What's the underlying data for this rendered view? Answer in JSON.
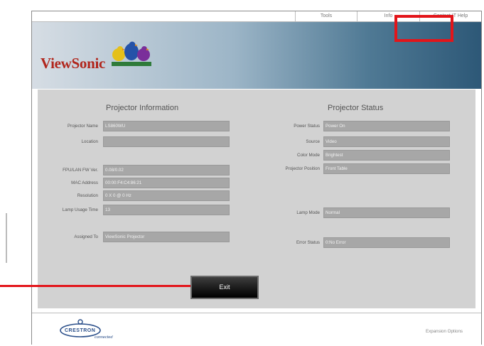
{
  "nav": {
    "tools": "Tools",
    "info": "Info",
    "contact": "Contact IT Help"
  },
  "brand": {
    "name": "ViewSonic"
  },
  "info": {
    "heading": "Projector Information",
    "fields": [
      {
        "label": "Projector Name",
        "value": "LS860WU"
      },
      {
        "label": "Location",
        "value": ""
      },
      {
        "label": "FPU/LAN FW Ver.",
        "value": "0.08/0.02"
      },
      {
        "label": "MAC Address",
        "value": "00:00:F4:C4:86:21"
      },
      {
        "label": "Resolution",
        "value": "0 X 0 @ 0 Hz"
      },
      {
        "label": "Lamp Usage Time",
        "value": "13"
      },
      {
        "label": "Assigned To",
        "value": "ViewSonic Projector"
      }
    ]
  },
  "status": {
    "heading": "Projector Status",
    "fields": [
      {
        "label": "Power Status",
        "value": "Power On"
      },
      {
        "label": "Source",
        "value": "Video"
      },
      {
        "label": "Color Mode",
        "value": "Brightest"
      },
      {
        "label": "Projector Position",
        "value": "Front Table"
      },
      {
        "label": "Lamp Mode",
        "value": "Normal"
      },
      {
        "label": "Error Status",
        "value": "0:No Error"
      }
    ]
  },
  "exit_label": "Exit",
  "footer": {
    "crestron_word": "CRESTRON",
    "crestron_sub": "connected",
    "expansion": "Expansion Options"
  },
  "colors": {
    "highlight": "#e3151a",
    "field_bg": "#a7a7a7",
    "panel_bg": "#d2d2d2"
  }
}
